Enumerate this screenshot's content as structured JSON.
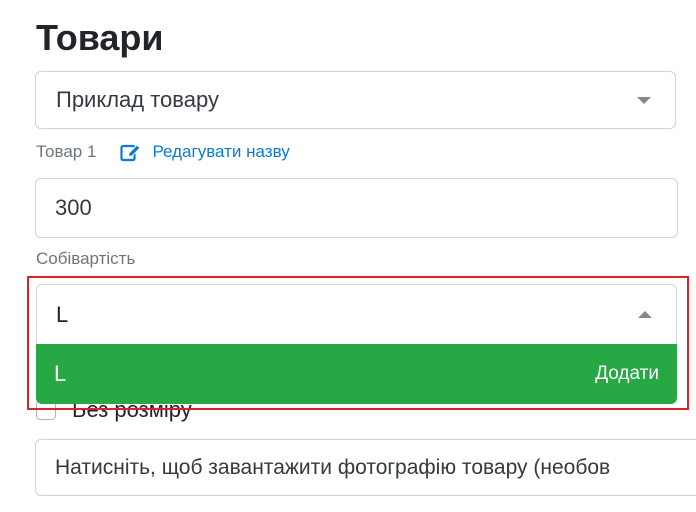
{
  "page": {
    "title": "Товари"
  },
  "product_select": {
    "value": "Приклад товару",
    "caret_icon": "chevron-down-icon"
  },
  "product_meta": {
    "label": "Товар 1",
    "edit_link_label": "Редагувати назву",
    "edit_icon": "pencil-square-icon"
  },
  "price_input": {
    "value": "300"
  },
  "cost_field": {
    "label": "Собівартість"
  },
  "size_dropdown": {
    "search_value": "L",
    "caret_icon": "chevron-up-icon",
    "option": {
      "label": "L",
      "action": "Додати"
    }
  },
  "no_size_checkbox": {
    "label": "Без розміру",
    "checked": false
  },
  "photo_upload": {
    "placeholder": "Натисніть, щоб завантажити фотографію товару (необов"
  },
  "colors": {
    "accent_link": "#0d7ad6",
    "option_highlight": "#28a745",
    "annotation_frame": "#d9232a"
  }
}
